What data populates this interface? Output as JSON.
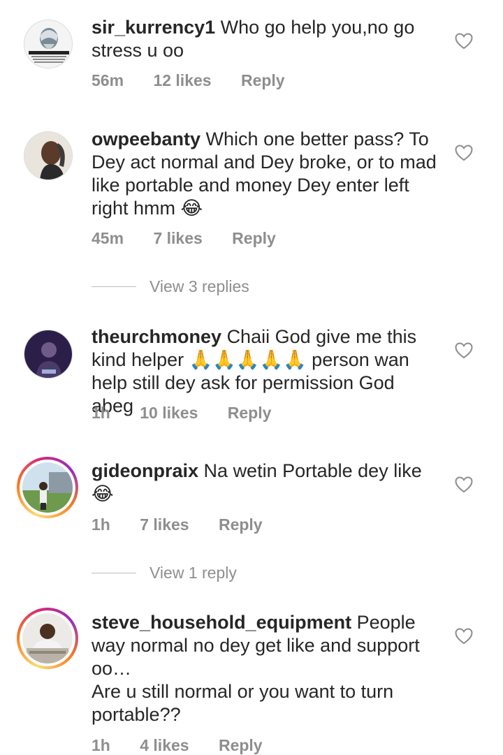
{
  "comments": [
    {
      "username": "sir_kurrency1",
      "text": "Who go help you,no go stress u oo",
      "time": "56m",
      "likes": "12 likes",
      "reply": "Reply",
      "avatar_text": "A WISE MAN SAID:"
    },
    {
      "username": "owpeebanty",
      "text": "Which one better pass? To Dey act normal and Dey broke, or to mad like portable and money Dey enter left right hmm 😂",
      "time": "45m",
      "likes": "7 likes",
      "reply": "Reply",
      "view_replies": "View 3 replies"
    },
    {
      "username": "theurchmoney",
      "text": "Chaii God give me this kind helper 🙏🙏🙏🙏🙏 person wan help still dey ask for permission God abeg",
      "time": "1h",
      "likes": "10 likes",
      "reply": "Reply"
    },
    {
      "username": "gideonpraix",
      "text": "Na wetin Portable dey like 😂",
      "time": "1h",
      "likes": "7 likes",
      "reply": "Reply",
      "view_replies": "View 1 reply"
    },
    {
      "username": "steve_household_equipment",
      "text_line1": "People way normal no dey get like and support oo…",
      "text_line2": "Are u still normal or you want to turn portable??",
      "time": "1h",
      "likes": "4 likes",
      "reply": "Reply"
    }
  ],
  "colors": {
    "text": "#262626",
    "meta": "#8e8e8e",
    "story_ring": "#d62976"
  }
}
